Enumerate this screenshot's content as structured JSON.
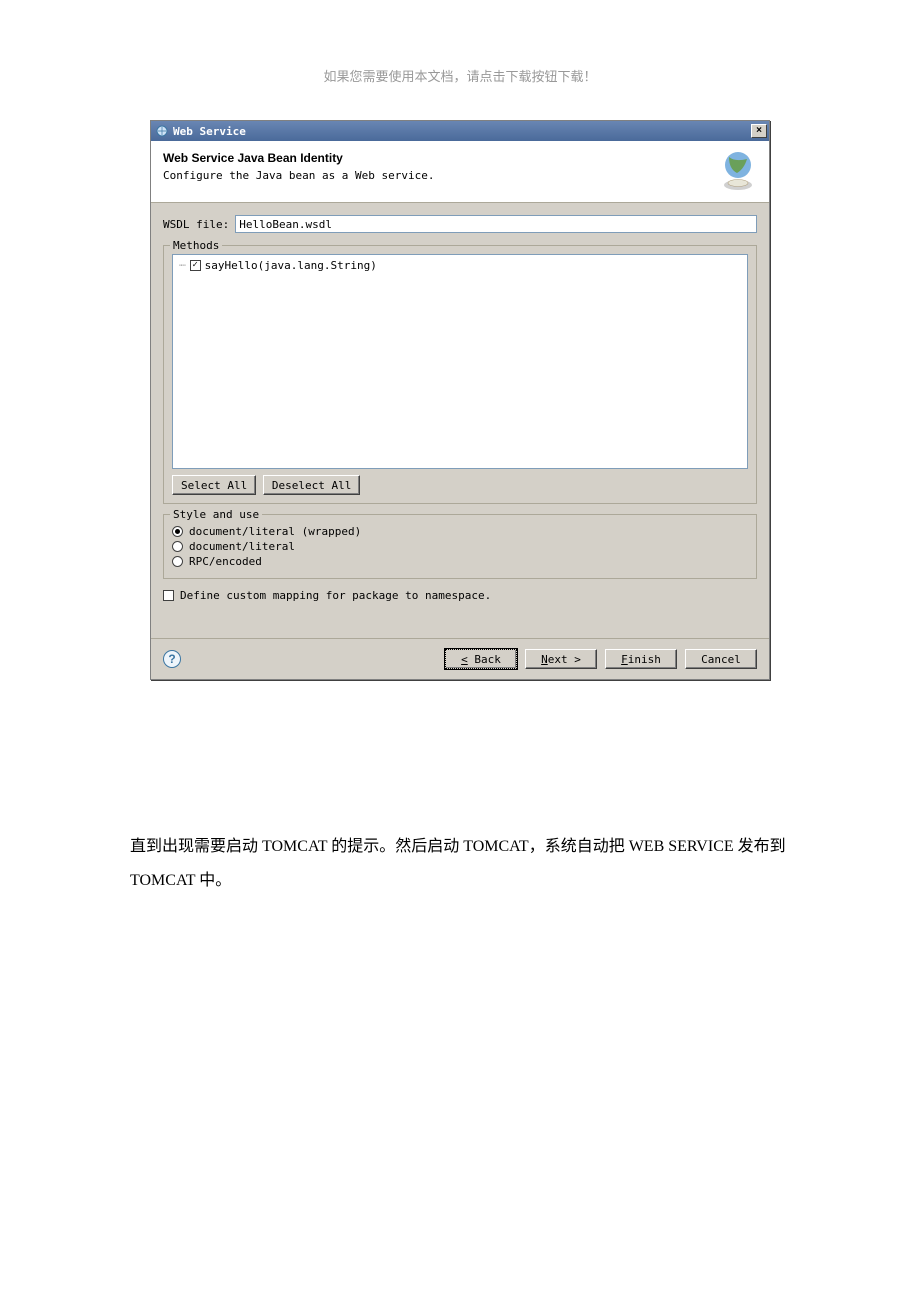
{
  "doc_header": "如果您需要使用本文档，请点击下载按钮下载！",
  "titlebar": {
    "title": "Web Service"
  },
  "header": {
    "title": "Web Service Java Bean Identity",
    "subtitle": "Configure the Java bean as a Web service."
  },
  "wsdl": {
    "label": "WSDL file:",
    "value": "HelloBean.wsdl"
  },
  "methods": {
    "legend": "Methods",
    "items": [
      "sayHello(java.lang.String)"
    ],
    "select_all": "Select All",
    "deselect_all": "Deselect All"
  },
  "style": {
    "legend": "Style and use",
    "options": [
      "document/literal (wrapped)",
      "document/literal",
      "RPC/encoded"
    ],
    "selected": 0
  },
  "mapping_checkbox": "Define custom mapping for package to namespace.",
  "footer": {
    "back": "< Back",
    "next": "Next >",
    "finish": "Finish",
    "cancel": "Cancel"
  },
  "doc_text": "直到出现需要启动 TOMCAT 的提示。然后启动 TOMCAT，系统自动把 WEB SERVICE 发布到 TOMCAT 中。"
}
